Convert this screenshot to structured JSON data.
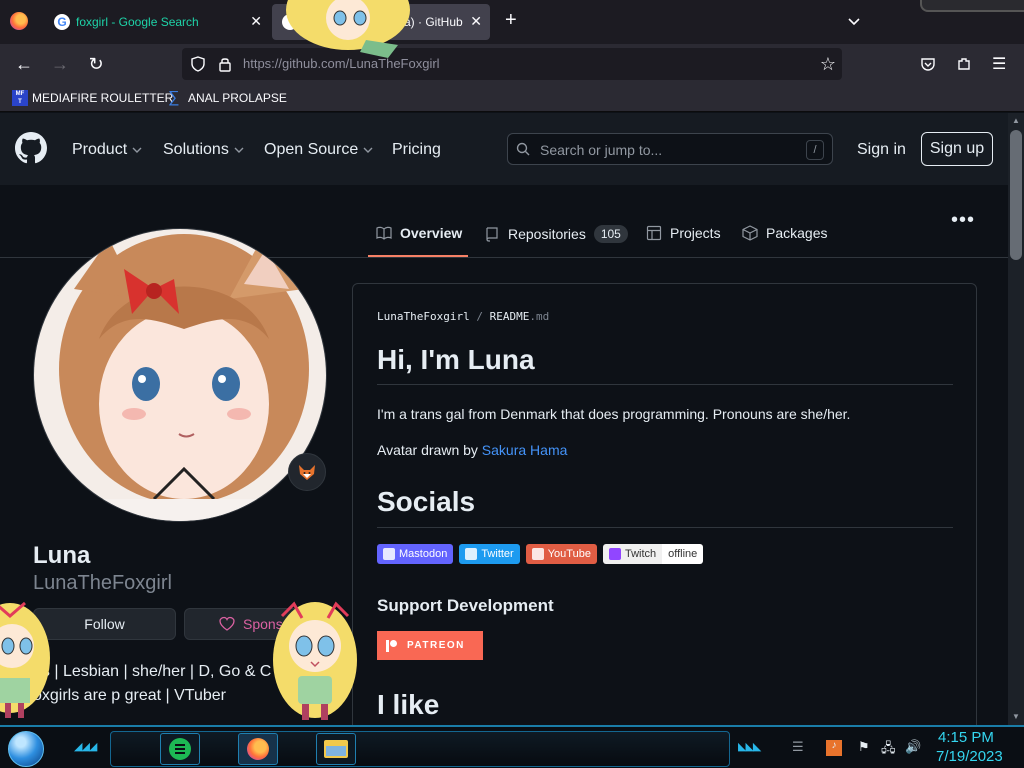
{
  "browser": {
    "tabs": [
      {
        "title": "foxgirl - Google Search",
        "active": false
      },
      {
        "title": "a) · GitHub",
        "active": true
      }
    ],
    "new_tab": "+",
    "url": "https://github.com/LunaTheFoxgirl",
    "bookmarks": [
      {
        "label": "MEDIAFIRE ROULETTER",
        "icon": "mediafire-icon"
      },
      {
        "label": "ANAL PROLAPSE",
        "icon": "sigma-icon"
      }
    ]
  },
  "github": {
    "nav": [
      "Product",
      "Solutions",
      "Open Source",
      "Pricing"
    ],
    "search_placeholder": "Search or jump to...",
    "search_key": "/",
    "sign_in": "Sign in",
    "sign_up": "Sign up"
  },
  "profile_tabs": [
    {
      "label": "Overview",
      "icon": "book-icon",
      "selected": true
    },
    {
      "label": "Repositories",
      "icon": "repo-icon",
      "count": "105"
    },
    {
      "label": "Projects",
      "icon": "table-icon"
    },
    {
      "label": "Packages",
      "icon": "package-icon"
    }
  ],
  "profile": {
    "name": "Luna",
    "login": "LunaTheFoxgirl",
    "follow": "Follow",
    "sponsor": "Sponsor",
    "bio_line1": "ns | Lesbian | she/her | D, Go & C",
    "bio_line2": "oxgirls are p great | VTuber"
  },
  "readme": {
    "crumb_user": "LunaTheFoxgirl",
    "crumb_sep": "/",
    "crumb_file": "README",
    "crumb_ext": ".md",
    "heading": "Hi, I'm Luna",
    "intro": "I'm a trans gal from Denmark that does programming. Pronouns are she/her.",
    "avatar_credit_prefix": "Avatar drawn by ",
    "avatar_credit_link": "Sakura Hama",
    "socials_heading": "Socials",
    "badges": [
      {
        "label": "Mastodon",
        "color": "#6364ff"
      },
      {
        "label": "Twitter",
        "color": "#1d9bf0"
      },
      {
        "label": "YouTube",
        "color": "#e05d44"
      },
      {
        "label": "Twitch",
        "color": "#f0f0f0"
      },
      {
        "label": "offline",
        "color": "#ffffff"
      }
    ],
    "support_heading": "Support Development",
    "patreon": "PATREON",
    "like_heading": "I like"
  },
  "taskbar": {
    "time": "4:15 PM",
    "date": "7/19/2023"
  },
  "colors": {
    "accent_tab": "#1ed3a8",
    "underline": "#f78166",
    "link": "#4493f8",
    "clock": "#34d6f0"
  }
}
